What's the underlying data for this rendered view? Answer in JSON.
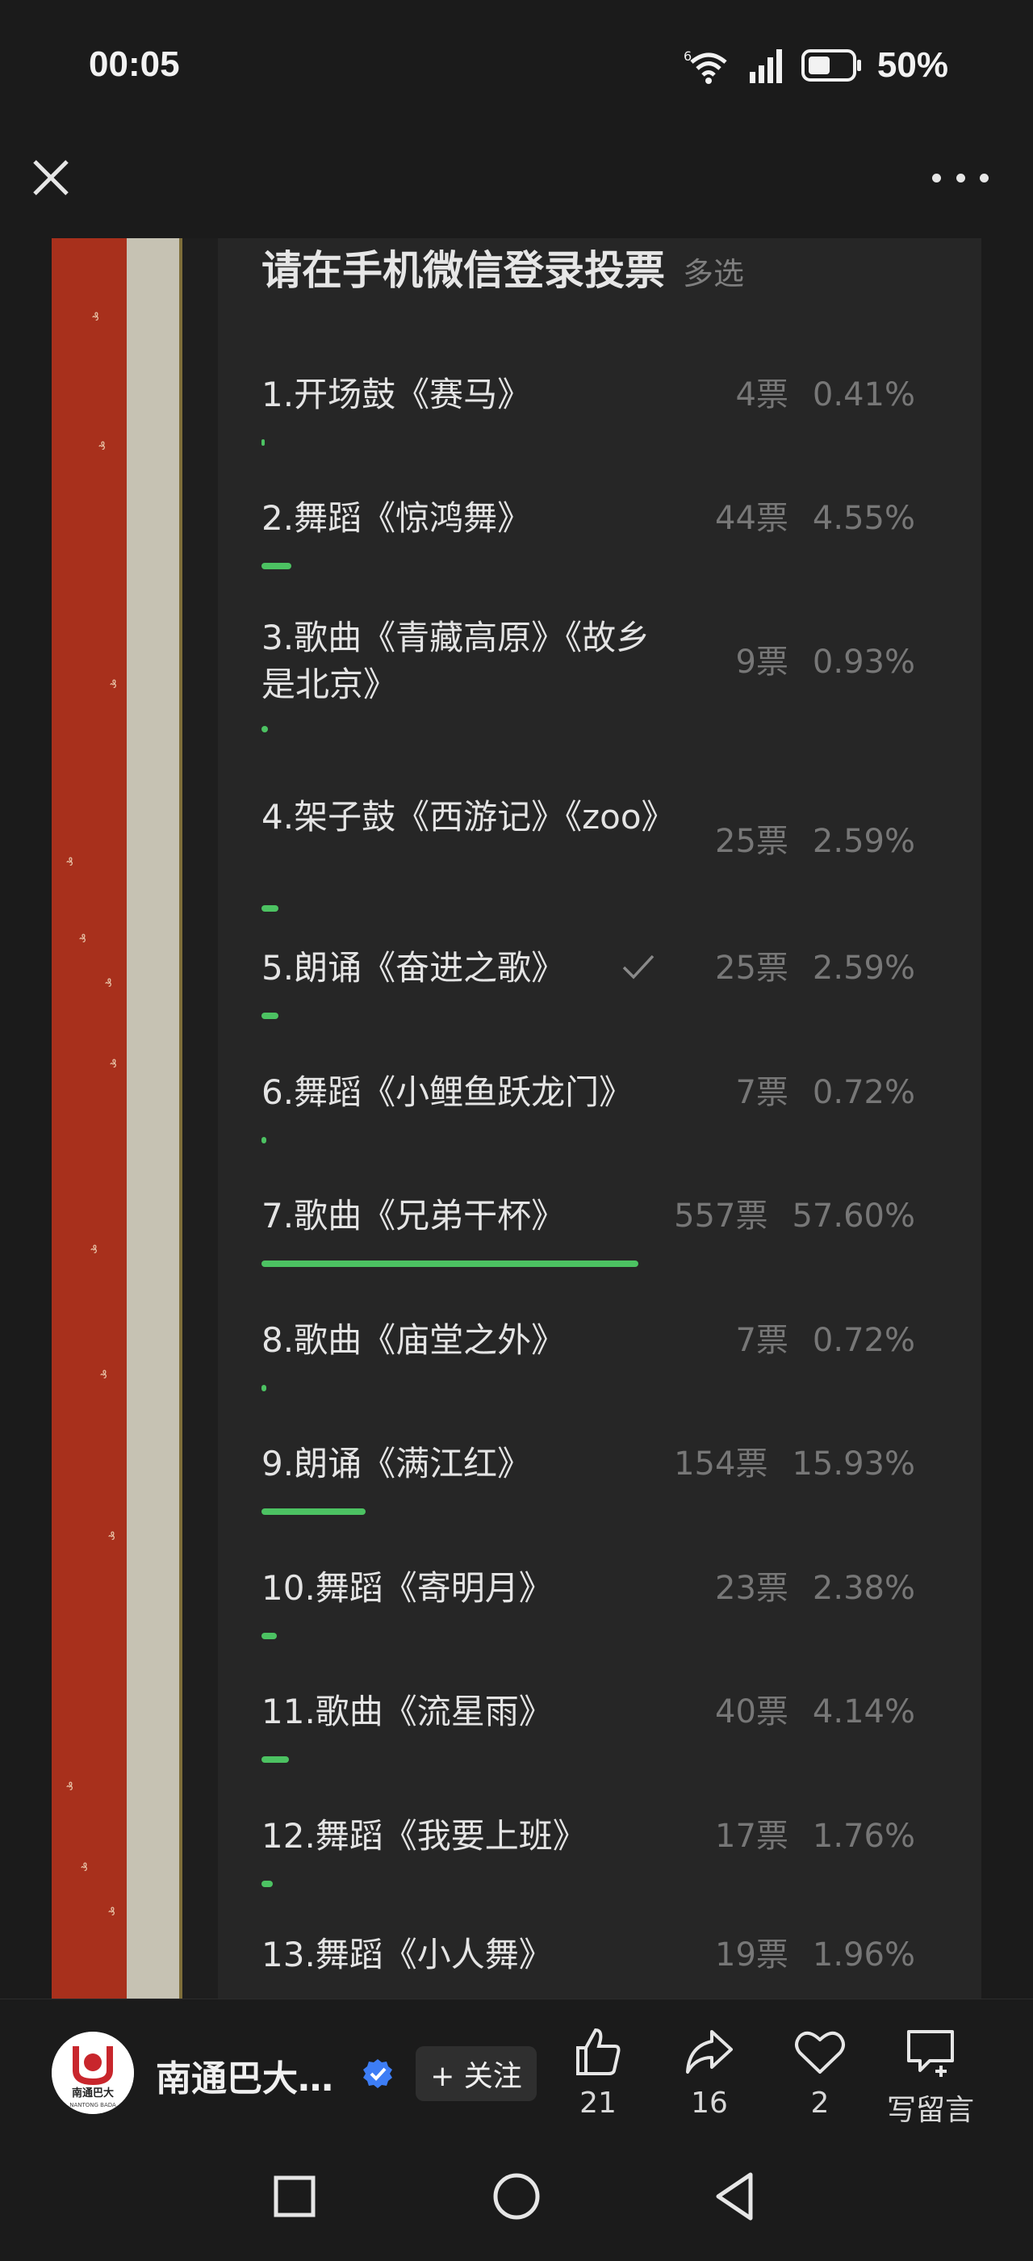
{
  "status_bar": {
    "time": "00:05",
    "battery_text": "50%",
    "wifi_label": "6"
  },
  "poll": {
    "title": "请在手机微信登录投票",
    "mode": "多选",
    "options": [
      {
        "label": "1.开场鼓《赛马》",
        "votes": "4票",
        "percent": "0.41%",
        "fraction": 0.0041,
        "checked": false
      },
      {
        "label": "2.舞蹈《惊鸿舞》",
        "votes": "44票",
        "percent": "4.55%",
        "fraction": 0.0455,
        "checked": false
      },
      {
        "label": "3.歌曲《青藏高原》《故乡是北京》",
        "votes": "9票",
        "percent": "0.93%",
        "fraction": 0.0093,
        "checked": false
      },
      {
        "label": "4.架子鼓《西游记》《zoo》",
        "votes": "25票",
        "percent": "2.59%",
        "fraction": 0.0259,
        "checked": false
      },
      {
        "label": "5.朗诵《奋进之歌》",
        "votes": "25票",
        "percent": "2.59%",
        "fraction": 0.0259,
        "checked": true
      },
      {
        "label": "6.舞蹈《小鲤鱼跃龙门》",
        "votes": "7票",
        "percent": "0.72%",
        "fraction": 0.0072,
        "checked": false
      },
      {
        "label": "7.歌曲《兄弟干杯》",
        "votes": "557票",
        "percent": "57.60%",
        "fraction": 0.576,
        "checked": false
      },
      {
        "label": "8.歌曲《庙堂之外》",
        "votes": "7票",
        "percent": "0.72%",
        "fraction": 0.0072,
        "checked": false
      },
      {
        "label": "9.朗诵《满江红》",
        "votes": "154票",
        "percent": "15.93%",
        "fraction": 0.1593,
        "checked": false
      },
      {
        "label": "10.舞蹈《寄明月》",
        "votes": "23票",
        "percent": "2.38%",
        "fraction": 0.0238,
        "checked": false
      },
      {
        "label": "11.歌曲《流星雨》",
        "votes": "40票",
        "percent": "4.14%",
        "fraction": 0.0414,
        "checked": false
      },
      {
        "label": "12.舞蹈《我要上班》",
        "votes": "17票",
        "percent": "1.76%",
        "fraction": 0.0176,
        "checked": false
      },
      {
        "label": "13.舞蹈《小人舞》",
        "votes": "19票",
        "percent": "1.96%",
        "fraction": 0.0196,
        "checked": false
      }
    ]
  },
  "bottom_bar": {
    "account_name": "南通巴大…",
    "follow_label": "+ 关注",
    "avatar_text": "南通巴大",
    "avatar_subtext": "NANTONG BADA",
    "like_count": "21",
    "share_count": "16",
    "favorite_count": "2",
    "comment_label": "写留言"
  },
  "colors": {
    "accent_green": "#4cc262",
    "verified_blue": "#3d7df5",
    "deco_red": "#a8301c"
  },
  "icons": [
    "close-icon",
    "more-icon",
    "wifi-icon",
    "signal-icon",
    "battery-icon",
    "check-icon",
    "verified-icon",
    "thumbs-up-icon",
    "share-icon",
    "heart-icon",
    "comment-icon",
    "nav-square-icon",
    "nav-circle-icon",
    "nav-back-icon"
  ]
}
